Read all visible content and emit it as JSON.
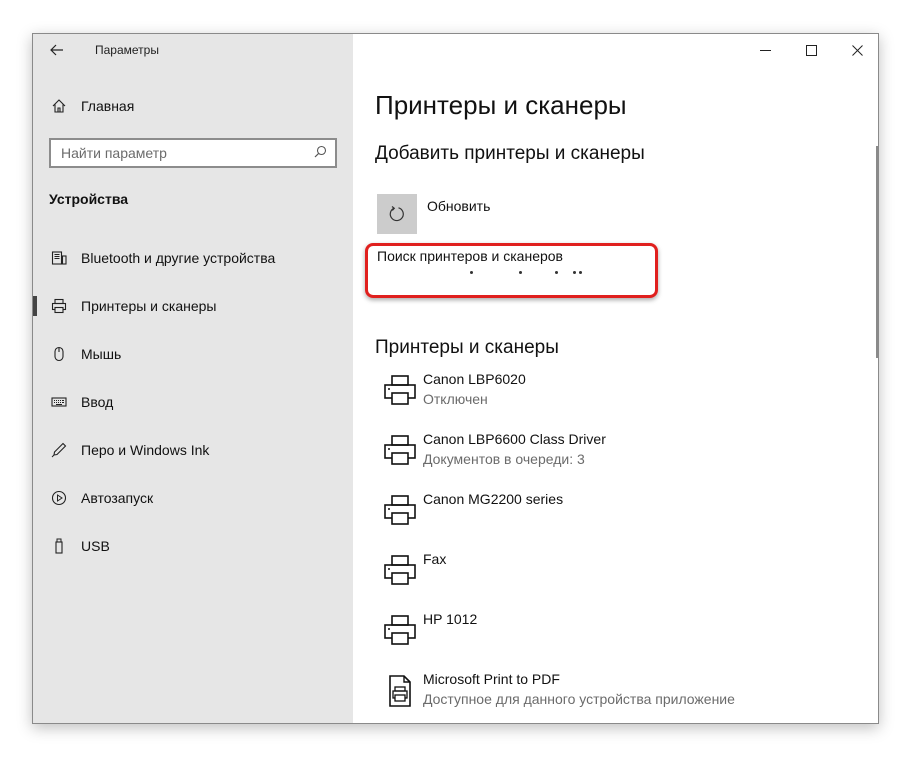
{
  "window": {
    "title": "Параметры"
  },
  "sidebar": {
    "home_label": "Главная",
    "search": {
      "placeholder": "Найти параметр",
      "value": ""
    },
    "section_title": "Устройства",
    "items": [
      {
        "label": "Bluetooth и другие устройства",
        "icon": "bluetooth-devices-icon",
        "active": false
      },
      {
        "label": "Принтеры и сканеры",
        "icon": "printer-icon",
        "active": true
      },
      {
        "label": "Мышь",
        "icon": "mouse-icon",
        "active": false
      },
      {
        "label": "Ввод",
        "icon": "keyboard-icon",
        "active": false
      },
      {
        "label": "Перо и Windows Ink",
        "icon": "pen-icon",
        "active": false
      },
      {
        "label": "Автозапуск",
        "icon": "autoplay-icon",
        "active": false
      },
      {
        "label": "USB",
        "icon": "usb-icon",
        "active": false
      }
    ]
  },
  "main": {
    "title": "Принтеры и сканеры",
    "add_heading": "Добавить принтеры и сканеры",
    "refresh_label": "Обновить",
    "searching_text": "Поиск принтеров и сканеров",
    "printers_heading": "Принтеры и сканеры",
    "printers": [
      {
        "name": "Canon LBP6020",
        "status": "Отключен",
        "icon": "printer-icon"
      },
      {
        "name": "Canon LBP6600 Class Driver",
        "status": "Документов в очереди: 3",
        "icon": "printer-icon"
      },
      {
        "name": "Canon MG2200 series",
        "status": "",
        "icon": "printer-icon"
      },
      {
        "name": "Fax",
        "status": "",
        "icon": "printer-icon"
      },
      {
        "name": "HP 1012",
        "status": "",
        "icon": "printer-icon"
      },
      {
        "name": "Microsoft Print to PDF",
        "status": "Доступное для данного устройства приложение",
        "icon": "pdf-printer-icon"
      }
    ]
  },
  "colors": {
    "sidebar_bg": "#e6e6e6",
    "highlight": "#e0201e",
    "tile_bg": "#cccccc"
  }
}
